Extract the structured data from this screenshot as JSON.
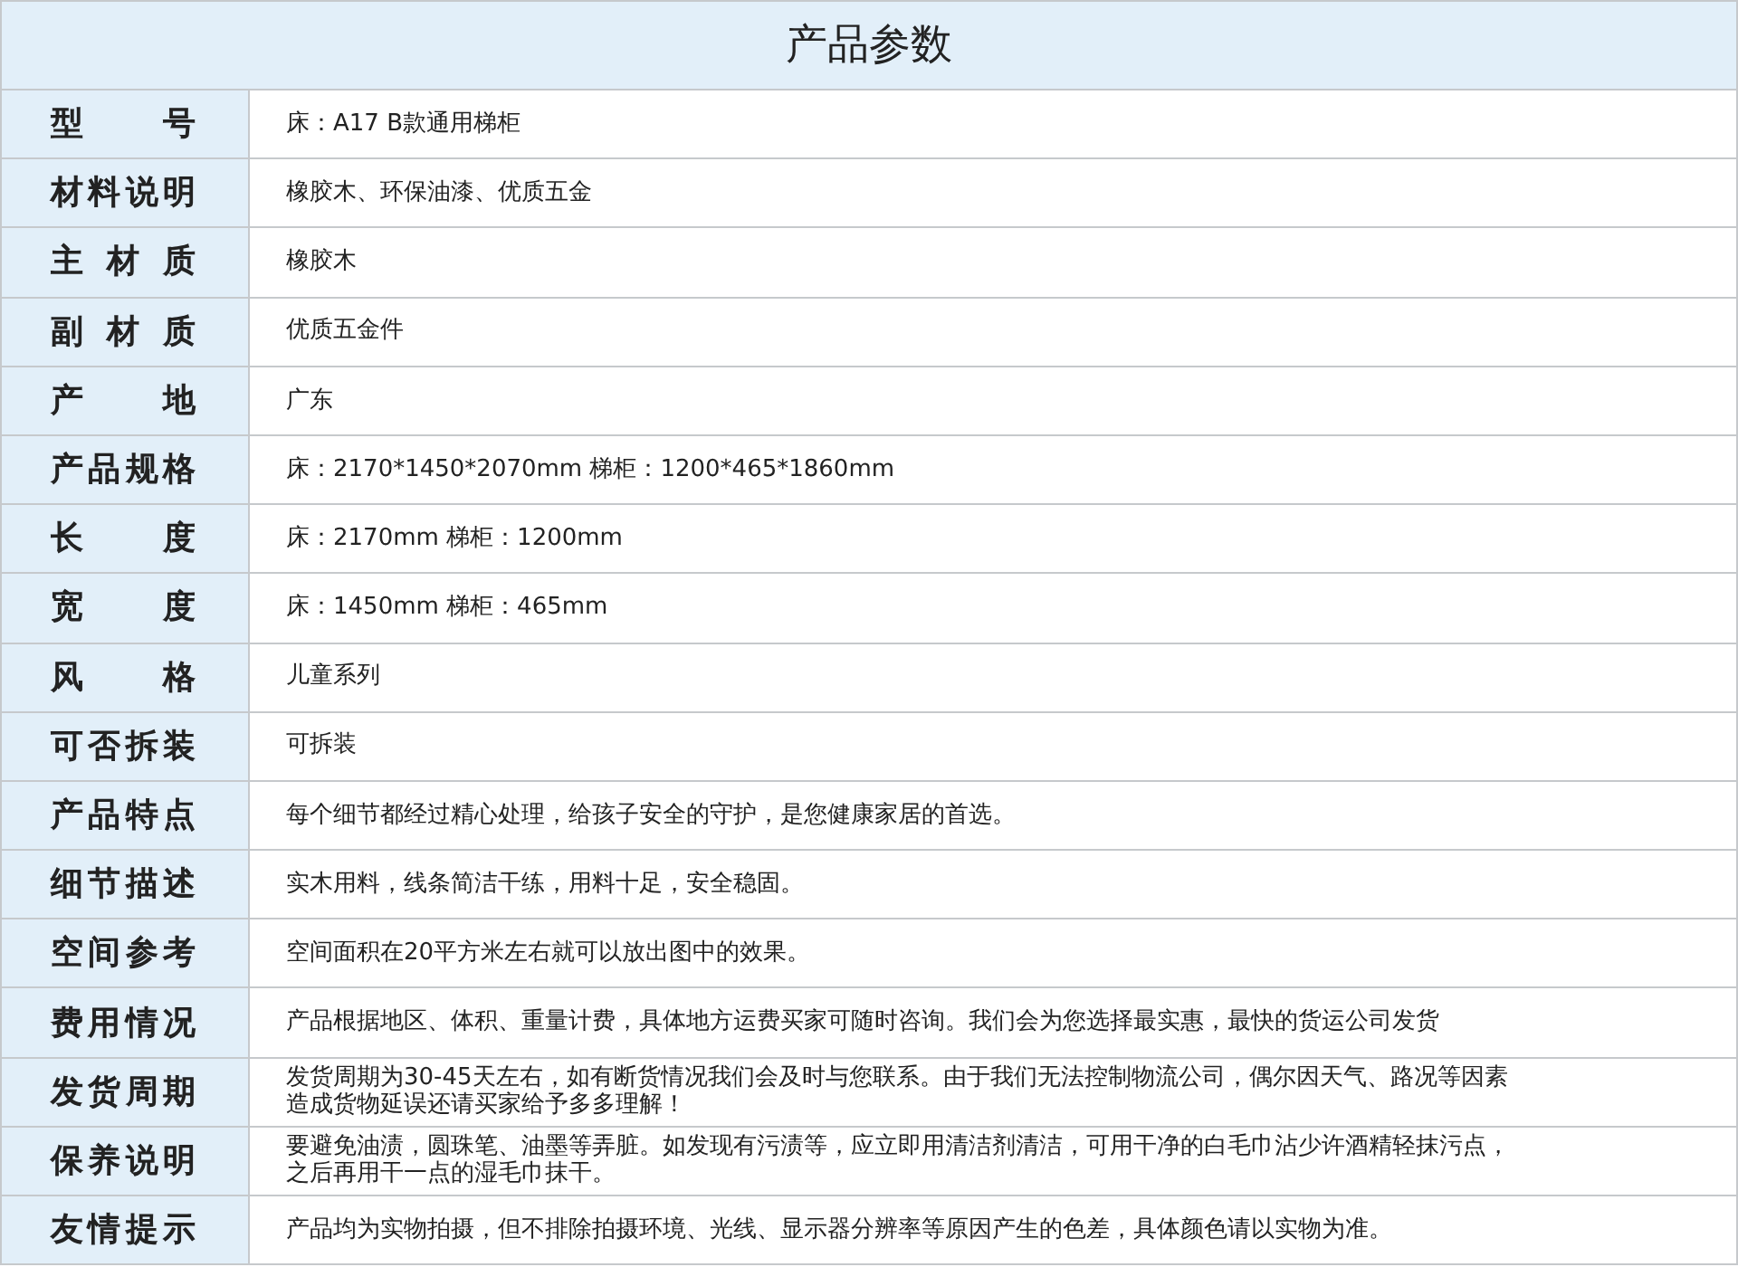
{
  "title": "产品参数",
  "rows": [
    {
      "label": "型 号",
      "value": "床：A17  B款通用梯柜"
    },
    {
      "label": "材料说明",
      "value": "橡胶木、环保油漆、优质五金"
    },
    {
      "label": "主 材 质",
      "value": "橡胶木"
    },
    {
      "label": "副 材 质",
      "value": "优质五金件"
    },
    {
      "label": "产 地",
      "value": "广东"
    },
    {
      "label": "产品规格",
      "value": "床：2170*1450*2070mm  梯柜：1200*465*1860mm"
    },
    {
      "label": "长 度",
      "value": "床：2170mm  梯柜：1200mm"
    },
    {
      "label": "宽 度",
      "value": "床：1450mm  梯柜：465mm"
    },
    {
      "label": "风 格",
      "value": "儿童系列"
    },
    {
      "label": "可否拆装",
      "value": "可拆装"
    },
    {
      "label": "产品特点",
      "value": "每个细节都经过精心处理，给孩子安全的守护，是您健康家居的首选。"
    },
    {
      "label": "细节描述",
      "value": "实木用料，线条简洁干练，用料十足，安全稳固。"
    },
    {
      "label": "空间参考",
      "value": "空间面积在20平方米左右就可以放出图中的效果。"
    },
    {
      "label": "费用情况",
      "value": "产品根据地区、体积、重量计费，具体地方运费买家可随时咨询。我们会为您选择最实惠，最快的货运公司发货"
    },
    {
      "label": "发货周期",
      "lines": [
        "发货周期为30-45天左右，如有断货情况我们会及时与您联系。由于我们无法控制物流公司，偶尔因天气、路况等因素",
        "造成货物延误还请买家给予多多理解！"
      ]
    },
    {
      "label": "保养说明",
      "lines": [
        "要避免油渍，圆珠笔、油墨等弄脏。如发现有污渍等，应立即用清洁剂清洁，可用干净的白毛巾沾少许酒精轻抹污点，",
        "之后再用干一点的湿毛巾抹干。"
      ]
    },
    {
      "label": "友情提示",
      "value": "产品均为实物拍摄，但不排除拍摄环境、光线、显示器分辨率等原因产生的色差，具体颜色请以实物为准。"
    }
  ]
}
